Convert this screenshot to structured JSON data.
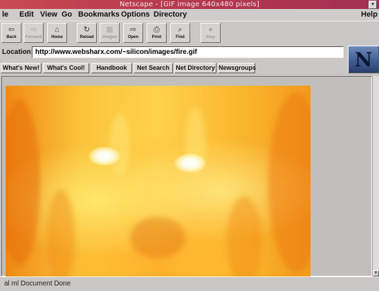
{
  "window": {
    "title": "Netscape - [GIF image 640x480 pixels]",
    "sys_button": "▾"
  },
  "menu": [
    "le",
    "Edit",
    "View",
    "Go",
    "Bookmarks",
    "Options",
    "Directory",
    "Help"
  ],
  "toolbar": {
    "buttons": [
      {
        "label": "Back",
        "icon": "⇦",
        "enabled": true
      },
      {
        "label": "Forward",
        "icon": "⇨",
        "enabled": false
      },
      {
        "label": "Home",
        "icon": "⌂",
        "enabled": true
      },
      {
        "label": "Reload",
        "icon": "↻",
        "enabled": true
      },
      {
        "label": "Images",
        "icon": "▦",
        "enabled": false
      },
      {
        "label": "Open",
        "icon": "⇨",
        "enabled": true
      },
      {
        "label": "Print",
        "icon": "⎙",
        "enabled": true
      },
      {
        "label": "Find",
        "icon": "⌕",
        "enabled": true
      },
      {
        "label": "Stop",
        "icon": "●",
        "enabled": false
      }
    ]
  },
  "location": {
    "label": "Location:",
    "url": "http://www.websharx.com/~silicon/images/fire.gif"
  },
  "logo": "N",
  "directory_buttons": [
    "What's New!",
    "What's Cool!",
    "Handbook",
    "Net Search",
    "Net Directory",
    "Newsgroups"
  ],
  "status": "al ml  Document Done",
  "colors": {
    "title_bar": "#b83a4e",
    "chrome": "#c9c8c6",
    "fire": "#fbc43a"
  }
}
